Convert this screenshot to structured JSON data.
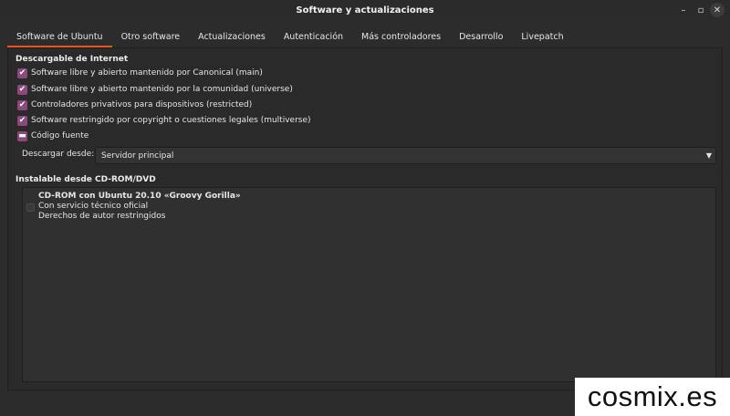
{
  "window": {
    "title": "Software y actualizaciones",
    "controls": {
      "minimize": "–",
      "maximize": "▫",
      "close": "✕"
    }
  },
  "tabs": [
    {
      "label": "Software de Ubuntu",
      "active": true
    },
    {
      "label": "Otro software",
      "active": false
    },
    {
      "label": "Actualizaciones",
      "active": false
    },
    {
      "label": "Autenticación",
      "active": false
    },
    {
      "label": "Más controladores",
      "active": false
    },
    {
      "label": "Desarrollo",
      "active": false
    },
    {
      "label": "Livepatch",
      "active": false
    }
  ],
  "internet": {
    "title": "Descargable de Internet",
    "options": [
      {
        "label": "Software libre y abierto mantenido por Canonical (main)",
        "state": "checked"
      },
      {
        "label": "Software libre y abierto mantenido por la comunidad (universe)",
        "state": "checked"
      },
      {
        "label": "Controladores privativos para dispositivos (restricted)",
        "state": "checked"
      },
      {
        "label": "Software restringido por copyright o cuestiones legales (multiverse)",
        "state": "checked"
      },
      {
        "label": "Código fuente",
        "state": "mixed"
      }
    ],
    "download_from_label": "Descargar desde:",
    "download_from_value": "Servidor principal"
  },
  "cdrom": {
    "title": "Instalable desde CD-ROM/DVD",
    "item": {
      "name": "CD-ROM con Ubuntu 20.10 «Groovy Gorilla»",
      "line2": "Con servicio técnico oficial",
      "line3": "Derechos de autor restringidos",
      "checked": false
    }
  },
  "watermark": "cosmix.es",
  "colors": {
    "accent": "#e95420",
    "checkbox": "#8a4a7e"
  }
}
